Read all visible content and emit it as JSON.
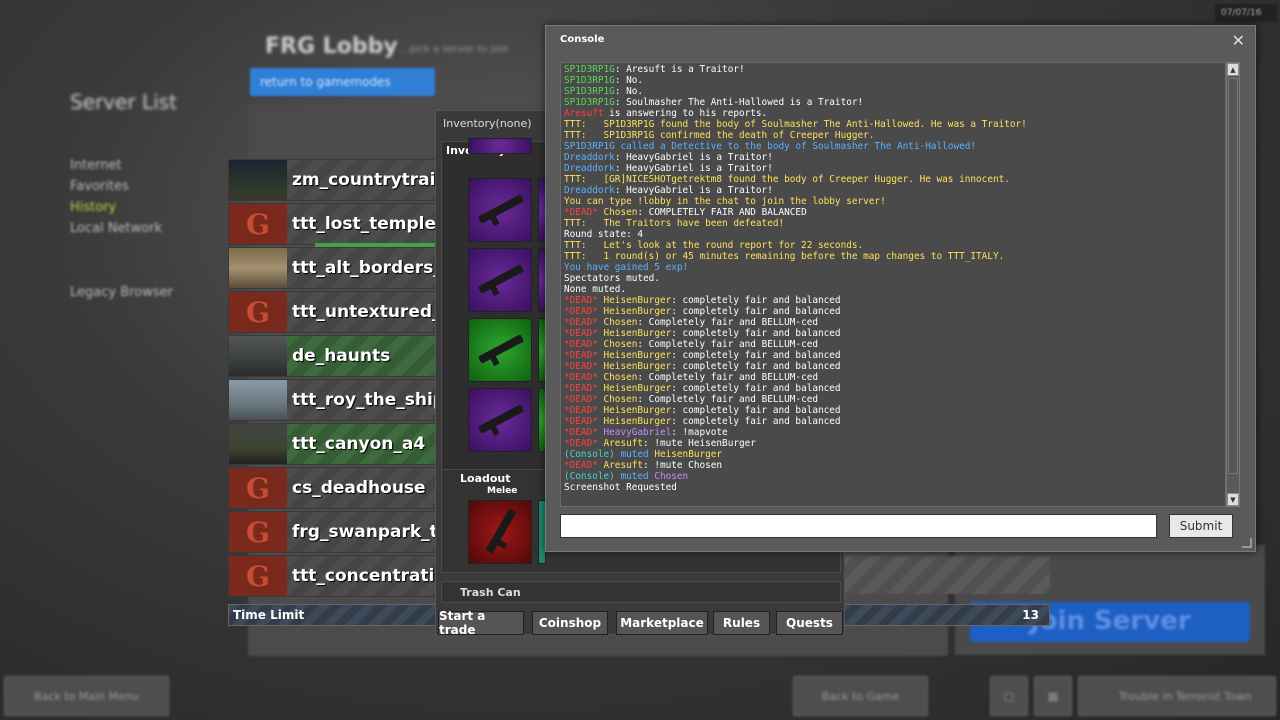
{
  "background": {
    "lobby_title": "FRG Lobby",
    "lobby_subtitle": "...pick a server to join",
    "return_button": "return to gamemodes",
    "server_list_title": "Server List",
    "nav": [
      "Internet",
      "Favorites",
      "History",
      "Local Network",
      "Legacy Browser"
    ],
    "join_button": "Join Server",
    "back_main_menu": "Back to Main Menu",
    "back_to_game": "Back to Game",
    "trouble_title": "Trouble in Terrorist Town",
    "clock": "07/07/16"
  },
  "maps": [
    {
      "name": "zm_countrytrain",
      "thumb": "photo1"
    },
    {
      "name": "ttt_lost_temple_",
      "thumb": "g"
    },
    {
      "name": "ttt_alt_borders_",
      "thumb": "photo2"
    },
    {
      "name": "ttt_untextured_",
      "thumb": "g"
    },
    {
      "name": "de_haunts",
      "thumb": "photo3"
    },
    {
      "name": "ttt_roy_the_ship",
      "thumb": "photo4"
    },
    {
      "name": "ttt_canyon_a4",
      "thumb": "photo5"
    },
    {
      "name": "cs_deadhouse",
      "thumb": "g"
    },
    {
      "name": "frg_swanpark_tt",
      "thumb": "g"
    },
    {
      "name": "ttt_concentratio",
      "thumb": "g"
    }
  ],
  "time_limit": {
    "label": "Time Limit",
    "value": "13"
  },
  "inventory": {
    "title": "Inventory(none)",
    "header": "Inventory",
    "loadout": "Loadout",
    "melee": "Melee",
    "trash": "Trash Can",
    "buttons": [
      "Start a trade",
      "Coinshop",
      "Marketplace",
      "Rules",
      "Quests"
    ]
  },
  "console": {
    "title": "Console",
    "close": "✕",
    "submit": "Submit",
    "input_value": "",
    "colors": {
      "green": "#5ad65a",
      "yellow": "#ffe05a",
      "white": "#ffffff",
      "red": "#ff4040",
      "blue": "#5ab0ff",
      "cyan": "#4ad0d0",
      "purple": "#c090ff"
    },
    "lines": [
      [
        [
          "SP1D3RP1G",
          "green"
        ],
        [
          ": Aresuft is a Traitor!",
          "white"
        ]
      ],
      [
        [
          "SP1D3RP1G",
          "green"
        ],
        [
          ": No.",
          "white"
        ]
      ],
      [
        [
          "SP1D3RP1G",
          "green"
        ],
        [
          ": No.",
          "white"
        ]
      ],
      [
        [
          "SP1D3RP1G",
          "green"
        ],
        [
          ": Soulmasher The Anti-Hallowed is a Traitor!",
          "white"
        ]
      ],
      [
        [
          "Aresuft",
          "red"
        ],
        [
          " is answering to his reports.",
          "white"
        ]
      ],
      [
        [
          "TTT:   SP1D3RP1G found the body of Soulmasher The Anti-Hallowed. He was a Traitor!",
          "yellow"
        ]
      ],
      [
        [
          "TTT:   SP1D3RP1G confirmed the death of Creeper Hugger.",
          "yellow"
        ]
      ],
      [
        [
          "SP1D3RP1G called a Detective to the body of Soulmasher The Anti-Hallowed!",
          "blue"
        ]
      ],
      [
        [
          "Dreaddork",
          "blue"
        ],
        [
          ": HeavyGabriel is a Traitor!",
          "white"
        ]
      ],
      [
        [
          "Dreaddork",
          "blue"
        ],
        [
          ": HeavyGabriel is a Traitor!",
          "white"
        ]
      ],
      [
        [
          "TTT:   [GR]NICESHOTgetrektm8 found the body of Creeper Hugger. He was innocent.",
          "yellow"
        ]
      ],
      [
        [
          "Dreaddork",
          "blue"
        ],
        [
          ": HeavyGabriel is a Traitor!",
          "white"
        ]
      ],
      [
        [
          "You can type !lobby in the chat to join the lobby server!",
          "yellow"
        ]
      ],
      [
        [
          "*DEAD* ",
          "red"
        ],
        [
          "Chosen",
          "yellow"
        ],
        [
          ": COMPLETELY FAIR AND BALANCED",
          "white"
        ]
      ],
      [
        [
          "TTT:   The Traitors have been defeated!",
          "yellow"
        ]
      ],
      [
        [
          "Round state: 4",
          "white"
        ]
      ],
      [
        [
          "TTT:   Let's look at the round report for 22 seconds.",
          "yellow"
        ]
      ],
      [
        [
          "TTT:   1 round(s) or 45 minutes remaining before the map changes to TTT_ITALY.",
          "yellow"
        ]
      ],
      [
        [
          "You have gained 5 exp!",
          "blue"
        ]
      ],
      [
        [
          "Spectators muted.",
          "white"
        ]
      ],
      [
        [
          "None muted.",
          "white"
        ]
      ],
      [
        [
          "*DEAD* ",
          "red"
        ],
        [
          "HeisenBurger",
          "yellow"
        ],
        [
          ": completely fair and balanced",
          "white"
        ]
      ],
      [
        [
          "*DEAD* ",
          "red"
        ],
        [
          "HeisenBurger",
          "yellow"
        ],
        [
          ": completely fair and balanced",
          "white"
        ]
      ],
      [
        [
          "*DEAD* ",
          "red"
        ],
        [
          "Chosen",
          "yellow"
        ],
        [
          ": Completely fair and BELLUM-ced",
          "white"
        ]
      ],
      [
        [
          "*DEAD* ",
          "red"
        ],
        [
          "HeisenBurger",
          "yellow"
        ],
        [
          ": completely fair and balanced",
          "white"
        ]
      ],
      [
        [
          "*DEAD* ",
          "red"
        ],
        [
          "Chosen",
          "yellow"
        ],
        [
          ": Completely fair and BELLUM-ced",
          "white"
        ]
      ],
      [
        [
          "*DEAD* ",
          "red"
        ],
        [
          "HeisenBurger",
          "yellow"
        ],
        [
          ": completely fair and balanced",
          "white"
        ]
      ],
      [
        [
          "*DEAD* ",
          "red"
        ],
        [
          "HeisenBurger",
          "yellow"
        ],
        [
          ": completely fair and balanced",
          "white"
        ]
      ],
      [
        [
          "*DEAD* ",
          "red"
        ],
        [
          "Chosen",
          "yellow"
        ],
        [
          ": Completely fair and BELLUM-ced",
          "white"
        ]
      ],
      [
        [
          "*DEAD* ",
          "red"
        ],
        [
          "HeisenBurger",
          "yellow"
        ],
        [
          ": completely fair and balanced",
          "white"
        ]
      ],
      [
        [
          "*DEAD* ",
          "red"
        ],
        [
          "Chosen",
          "yellow"
        ],
        [
          ": Completely fair and BELLUM-ced",
          "white"
        ]
      ],
      [
        [
          "*DEAD* ",
          "red"
        ],
        [
          "HeisenBurger",
          "yellow"
        ],
        [
          ": completely fair and balanced",
          "white"
        ]
      ],
      [
        [
          "*DEAD* ",
          "red"
        ],
        [
          "HeisenBurger",
          "yellow"
        ],
        [
          ": completely fair and balanced",
          "white"
        ]
      ],
      [
        [
          "*DEAD* ",
          "red"
        ],
        [
          "HeavyGabriel",
          "purple"
        ],
        [
          ": !mapvote",
          "white"
        ]
      ],
      [
        [
          "*DEAD* ",
          "red"
        ],
        [
          "Aresuft",
          "yellow"
        ],
        [
          ": !mute HeisenBurger",
          "white"
        ]
      ],
      [
        [
          "(Console)",
          "cyan"
        ],
        [
          " muted ",
          "blue"
        ],
        [
          "HeisenBurger",
          "yellow"
        ]
      ],
      [
        [
          "*DEAD* ",
          "red"
        ],
        [
          "Aresuft",
          "yellow"
        ],
        [
          ": !mute Chosen",
          "white"
        ]
      ],
      [
        [
          "(Console)",
          "cyan"
        ],
        [
          " muted ",
          "blue"
        ],
        [
          "Chosen",
          "purple"
        ]
      ],
      [
        [
          "Screenshot Requested",
          "white"
        ]
      ]
    ]
  }
}
